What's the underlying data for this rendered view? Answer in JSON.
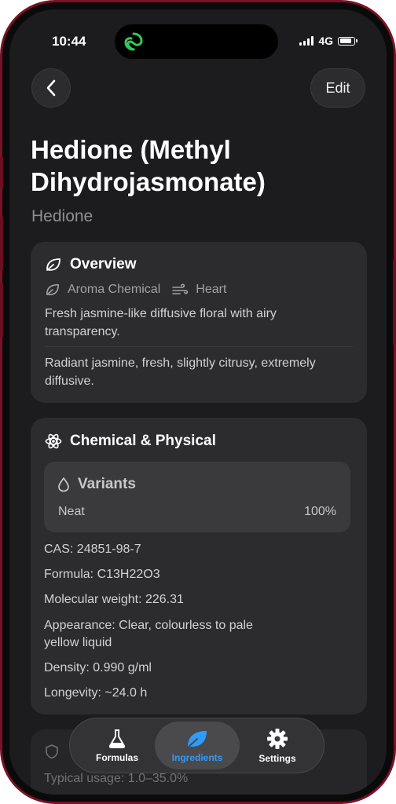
{
  "status": {
    "time": "10:44",
    "network": "4G"
  },
  "nav": {
    "edit_label": "Edit"
  },
  "header": {
    "title": "Hedione (Methyl Dihydrojasmonate)",
    "subtitle": "Hedione"
  },
  "overview": {
    "heading": "Overview",
    "category": "Aroma Chemical",
    "note": "Heart",
    "description": "Fresh jasmine-like diffusive floral with airy transparency.",
    "odor_profile": "Radiant jasmine, fresh, slightly citrusy, extremely diffusive."
  },
  "chemical": {
    "heading": "Chemical & Physical",
    "variants": {
      "heading": "Variants",
      "items": [
        {
          "name": "Neat",
          "percent": "100%"
        }
      ]
    },
    "cas": "CAS: 24851-98-7",
    "formula": "Formula: C13H22O3",
    "molecular_weight": "Molecular weight: 226.31",
    "appearance": "Appearance: Clear, colourless to pale yellow liquid",
    "density": "Density: 0.990 g/ml",
    "longevity": "Longevity: ~24.0 h"
  },
  "safety": {
    "usage": "Typical usage: 1.0–35.0%"
  },
  "tabbar": {
    "tabs": [
      {
        "label": "Formulas",
        "icon": "flask-icon"
      },
      {
        "label": "Ingredients",
        "icon": "leaf-icon",
        "active": true
      },
      {
        "label": "Settings",
        "icon": "gear-icon"
      }
    ]
  },
  "colors": {
    "frame": "#7a1126",
    "background": "#1c1c1e",
    "card": "#2c2c2e",
    "accent": "#2f9bff",
    "island_logo": "#34c759"
  }
}
